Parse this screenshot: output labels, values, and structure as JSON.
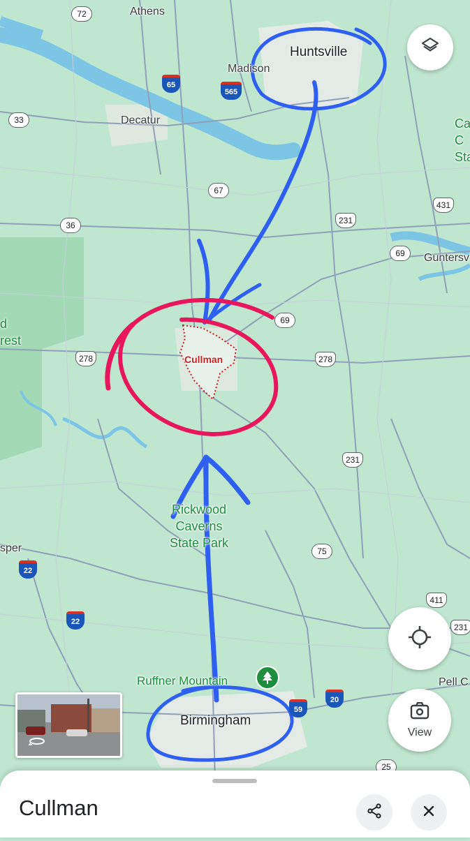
{
  "map": {
    "water_color": "#7cc5e4",
    "land_color": "#bfe6cf",
    "urban_color": "#e4ebe6",
    "road_color": "#8fa0b8",
    "annotation_blue": "#2f5ff0",
    "annotation_red": "#e8175d",
    "labels": {
      "athens": "Athens",
      "huntsville": "Huntsville",
      "madison": "Madison",
      "decatur": "Decatur",
      "cullman": "Cullman",
      "guntersville": "Guntersv",
      "forest": "d\nrest",
      "edge_c": "Ca\nC\nSta",
      "park_line1": "Rickwood",
      "park_line2": "Caverns",
      "park_line3": "State Park",
      "jasper": "sper",
      "ruffner": "Ruffner Mountain",
      "birmingham": "Birmingham",
      "pell": "Pell C"
    },
    "shields": {
      "s72": "72",
      "s33": "33",
      "s36": "36",
      "s67": "67",
      "s69a": "69",
      "s69b": "69",
      "s231a": "231",
      "s231b": "231",
      "s231c": "231",
      "s431": "431",
      "s278a": "278",
      "s278b": "278",
      "s75": "75",
      "s411": "411",
      "s25": "25"
    },
    "interstates": {
      "i65": "65",
      "i565": "565",
      "i22a": "22",
      "i22b": "22",
      "i59": "59",
      "i20": "20"
    }
  },
  "controls": {
    "layers_icon": "layers-icon",
    "location_icon": "my-location-icon",
    "view_label": "View"
  },
  "sheet": {
    "title": "Cullman",
    "share_icon": "share-icon",
    "close_icon": "close-icon"
  }
}
